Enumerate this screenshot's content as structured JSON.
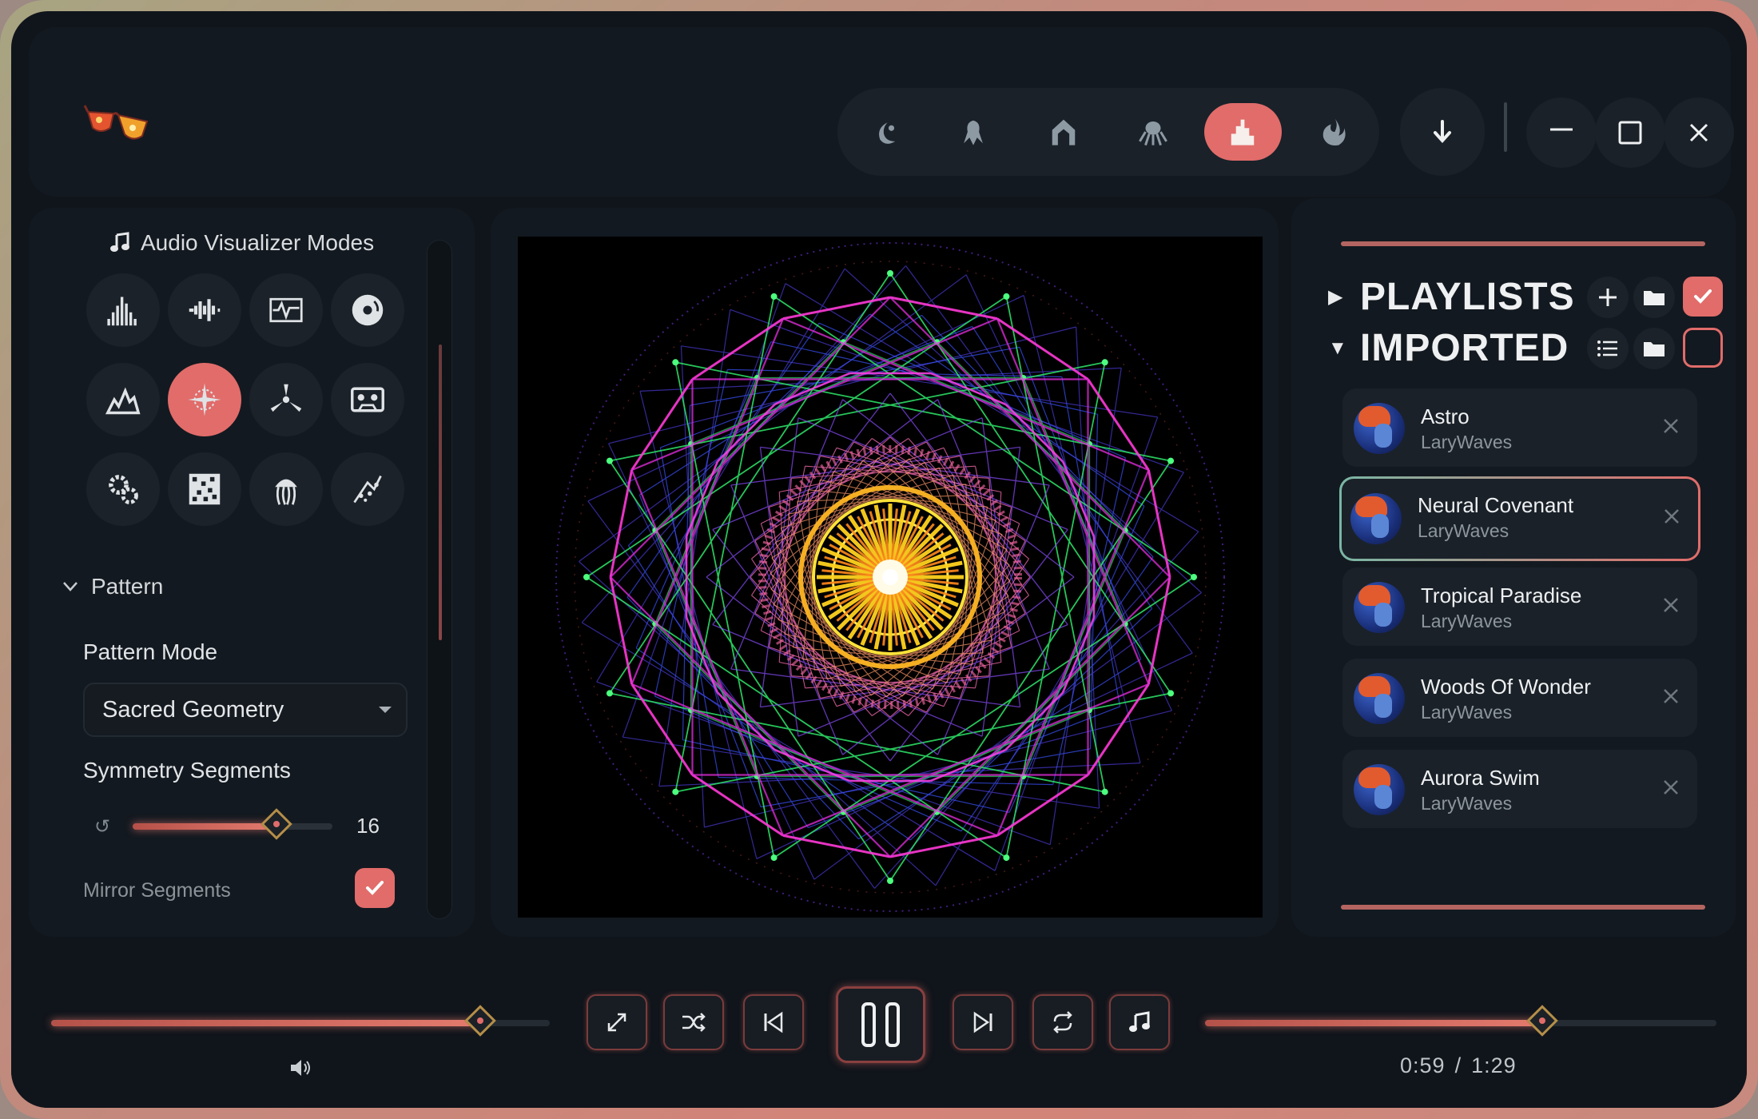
{
  "header": {
    "logo_icon": "sunglasses-icon",
    "visualizer_tabs": [
      {
        "icon": "moon-flame-icon",
        "active": false
      },
      {
        "icon": "kraken-icon",
        "active": false
      },
      {
        "icon": "temple-icon",
        "active": false
      },
      {
        "icon": "octopus-icon",
        "active": false
      },
      {
        "icon": "city-icon",
        "active": true
      },
      {
        "icon": "fire-icon",
        "active": false
      }
    ],
    "download_icon": "download-icon"
  },
  "left_panel": {
    "title": "Audio Visualizer Modes",
    "modes": [
      {
        "icon": "bars-spectrum-icon",
        "active": false
      },
      {
        "icon": "waveform-icon",
        "active": false
      },
      {
        "icon": "oscilloscope-icon",
        "active": false
      },
      {
        "icon": "vinyl-icon",
        "active": false
      },
      {
        "icon": "mountain-wave-icon",
        "active": false
      },
      {
        "icon": "radial-burst-icon",
        "active": true
      },
      {
        "icon": "propeller-icon",
        "active": false
      },
      {
        "icon": "cassette-icon",
        "active": false
      },
      {
        "icon": "gears-icon",
        "active": false
      },
      {
        "icon": "noise-grid-icon",
        "active": false
      },
      {
        "icon": "jellyfish-icon",
        "active": false
      },
      {
        "icon": "particles-icon",
        "active": false
      }
    ],
    "section_label": "Pattern",
    "pattern_mode_label": "Pattern Mode",
    "pattern_mode_value": "Sacred Geometry",
    "symmetry_label": "Symmetry Segments",
    "symmetry_value": "16",
    "symmetry_fraction": 0.72,
    "mirror_label": "Mirror Segments",
    "mirror_checked": true
  },
  "right_panel": {
    "groups": [
      {
        "title": "PLAYLISTS",
        "expanded": false,
        "checked": true
      },
      {
        "title": "IMPORTED",
        "expanded": true,
        "checked": false
      }
    ],
    "tracks": [
      {
        "title": "Astro",
        "artist": "LaryWaves",
        "active": false
      },
      {
        "title": "Neural Covenant",
        "artist": "LaryWaves",
        "active": true
      },
      {
        "title": "Tropical Paradise",
        "artist": "LaryWaves",
        "active": false
      },
      {
        "title": "Woods Of Wonder",
        "artist": "LaryWaves",
        "active": false
      },
      {
        "title": "Aurora Swim",
        "artist": "LaryWaves",
        "active": false
      }
    ]
  },
  "player": {
    "volume_fraction": 0.86,
    "progress_fraction": 0.66,
    "current_time": "0:59",
    "separator": "/",
    "total_time": "1:29",
    "controls": [
      "fullscreen-icon",
      "shuffle-icon",
      "previous-icon",
      "pause-icon",
      "next-icon",
      "repeat-icon",
      "music-note-icon"
    ]
  },
  "colors": {
    "accent": "#e16c6a",
    "background": "#10151b",
    "panel": "#131920"
  }
}
